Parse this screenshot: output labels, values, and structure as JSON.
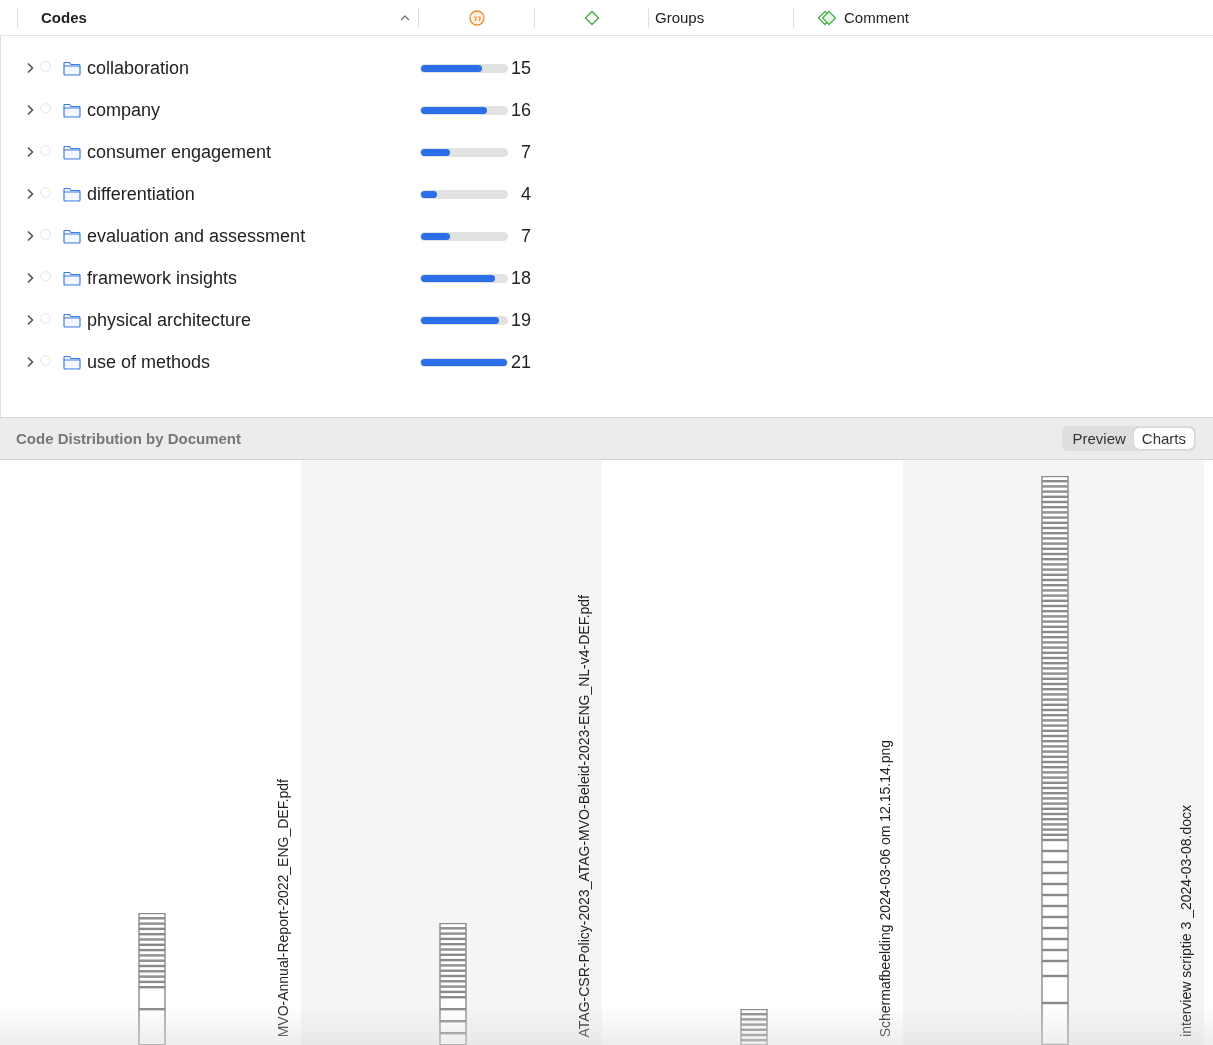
{
  "table": {
    "columns": [
      {
        "kind": "text",
        "label": "Codes"
      },
      {
        "kind": "quote"
      },
      {
        "kind": "diamond"
      },
      {
        "kind": "text",
        "label": "Groups"
      },
      {
        "kind": "comment",
        "label": "Comment"
      }
    ],
    "rows": [
      {
        "name": "collaboration",
        "level": 0.714,
        "count": "15"
      },
      {
        "name": "company",
        "level": 0.762,
        "count": "16"
      },
      {
        "name": "consumer engagement",
        "level": 0.333,
        "count": "7"
      },
      {
        "name": "differentiation",
        "level": 0.19,
        "count": "4"
      },
      {
        "name": "evaluation and assessment",
        "level": 0.333,
        "count": "7"
      },
      {
        "name": "framework insights",
        "level": 0.857,
        "count": "18"
      },
      {
        "name": "physical architecture",
        "level": 0.905,
        "count": "19"
      },
      {
        "name": "use of methods",
        "level": 1,
        "count": "21"
      }
    ]
  },
  "panel": {
    "title": "Code Distribution by Document",
    "tabs": [
      {
        "label": "Preview",
        "selected": false
      },
      {
        "label": "Charts",
        "selected": true
      }
    ],
    "documents": [
      "MVO-Annual-Report-2022_ENG_DEF.pdf",
      "ATAG-CSR-Policy-2023_ATAG-MVO-Beleid-2023-ENG_NL-v4-DEF.pdf",
      "Schermafbeelding 2024-03-06 om 12.15.14.png",
      "interview scriptie 3 _2024-03-08.docx"
    ]
  }
}
